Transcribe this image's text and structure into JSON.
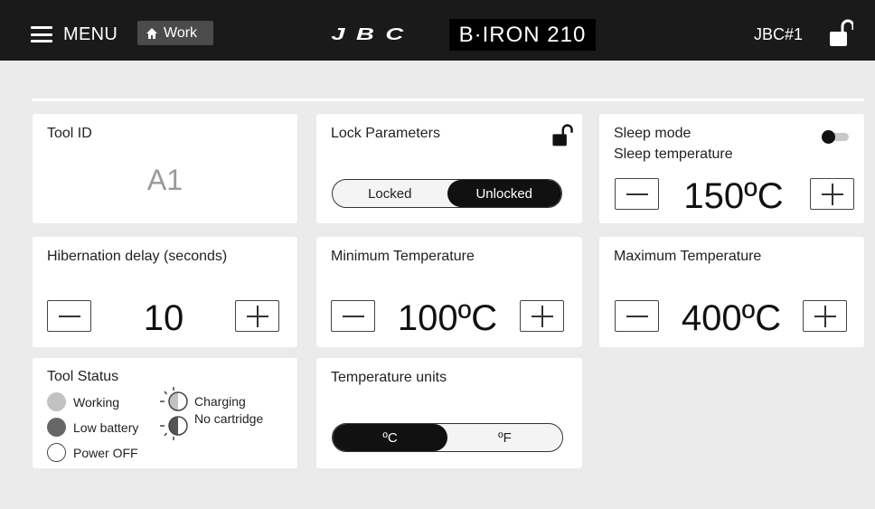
{
  "header": {
    "menu_label": "MENU",
    "work_label": "Work",
    "brand": "JBC",
    "model": "B·IRON 210",
    "station_id": "JBC#1",
    "lock_state_icon": "unlocked-padlock-icon"
  },
  "cards": {
    "tool_id": {
      "title": "Tool ID",
      "value": "A1"
    },
    "lock_parameters": {
      "title": "Lock Parameters",
      "options": [
        "Locked",
        "Unlocked"
      ],
      "selected": "Unlocked"
    },
    "sleep_mode": {
      "title": "Sleep mode",
      "subtitle": "Sleep temperature",
      "toggle_on": false,
      "value": "150ºC"
    },
    "hibernation_delay": {
      "title": "Hibernation delay (seconds)",
      "value": "10"
    },
    "minimum_temperature": {
      "title": "Minimum Temperature",
      "value": "100ºC"
    },
    "maximum_temperature": {
      "title": "Maximum Temperature",
      "value": "400ºC"
    },
    "tool_status": {
      "title": "Tool Status",
      "legend": {
        "working": "Working",
        "low_battery": "Low battery",
        "power_off": "Power OFF",
        "charging": "Charging",
        "no_cartridge": "No cartridge"
      }
    },
    "temperature_units": {
      "title": "Temperature units",
      "options": [
        "ºC",
        "ºF"
      ],
      "selected": "ºC"
    }
  },
  "colors": {
    "header_bg": "#1a1a1a",
    "page_bg": "#ebebeb",
    "card_bg": "#ffffff",
    "active_segment": "#111111",
    "working_dot": "#c2c2c2",
    "low_battery_dot": "#666666"
  }
}
